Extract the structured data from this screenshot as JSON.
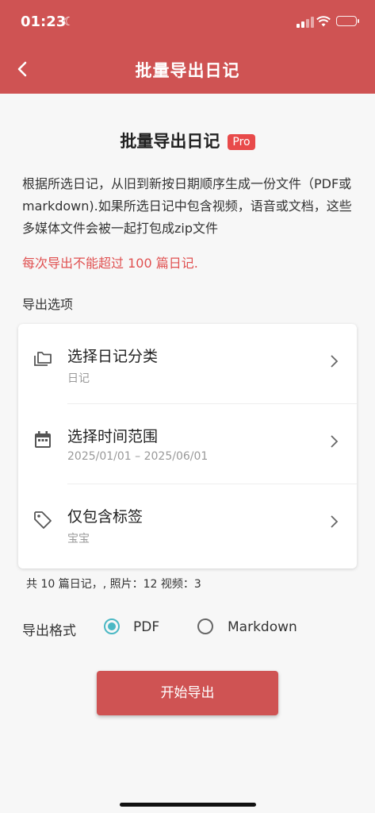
{
  "status_bar": {
    "time": "01:23"
  },
  "nav": {
    "title": "批量导出日记"
  },
  "page": {
    "title": "批量导出日记",
    "badge": "Pro",
    "description": "根据所选日记，从旧到新按日期顺序生成一份文件（PDF或markdown).如果所选日记中包含视频，语音或文档，这些多媒体文件会被一起打包成zip文件",
    "warning": "每次导出不能超过 100 篇日记.",
    "section_label": "导出选项"
  },
  "options": [
    {
      "label": "选择日记分类",
      "sub": "日记",
      "icon": "folder-icon"
    },
    {
      "label": "选择时间范围",
      "sub": "2025/01/01 – 2025/06/01",
      "icon": "calendar-icon"
    },
    {
      "label": "仅包含标签",
      "sub": "宝宝",
      "icon": "tag-icon"
    }
  ],
  "stats": "共 10 篇日记，, 照片：12 视频：3",
  "format": {
    "label": "导出格式",
    "options": [
      "PDF",
      "Markdown"
    ],
    "selected": "PDF"
  },
  "start_button": "开始导出",
  "colors": {
    "accent": "#cf5353",
    "badge": "#e84a4a",
    "warning": "#e05050",
    "radio": "#4bb8c4"
  }
}
